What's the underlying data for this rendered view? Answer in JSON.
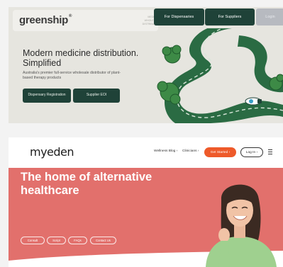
{
  "greenship": {
    "logo": "greenship",
    "logo_mark": "®",
    "tagline": "MEDICINE WHOLESALE DISTRIBUTION",
    "nav": {
      "dispensaries": "For Dispensaries",
      "suppliers": "For Suppliers",
      "login": "Login"
    },
    "hero": {
      "title": "Modern medicine distribution. Simplified",
      "subtitle": "Australia's premier full-service wholesale distributor of plant-based therapy products"
    },
    "cta": {
      "registration": "Dispensary Registration",
      "supplier_eoi": "Supplier EOI"
    },
    "colors": {
      "brand_dark": "#1f4238",
      "road": "#2a6b43",
      "background": "#e6e5df"
    }
  },
  "myeden": {
    "logo": "myeden",
    "nav": {
      "blog": "Wellness Blog",
      "clinicians": "Clinicians",
      "get_started": "Get Started",
      "login": "Log In",
      "menu_icon": "hamburger-icon"
    },
    "hero": {
      "title": "The home of alternative healthcare",
      "pills": [
        "Consult",
        "Script",
        "FAQs",
        "Contact Us"
      ]
    },
    "colors": {
      "hero_bg": "#e2706c",
      "cta": "#ee5a2a"
    }
  }
}
